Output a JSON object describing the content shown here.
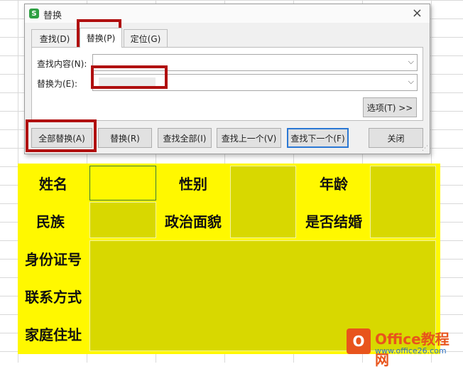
{
  "dialog": {
    "title": "替换",
    "tabs": [
      {
        "label": "查找(D)"
      },
      {
        "label": "替换(P)",
        "active": true
      },
      {
        "label": "定位(G)"
      }
    ],
    "find_label": "查找内容(N):",
    "find_value": "",
    "replace_label": "替换为(E):",
    "replace_value": "",
    "options_button": "选项(T) >>",
    "buttons": {
      "replace_all": "全部替换(A)",
      "replace": "替换(R)",
      "find_all": "查找全部(I)",
      "find_prev": "查找上一个(V)",
      "find_next": "查找下一个(F)",
      "close": "关闭"
    }
  },
  "sheet": {
    "labels": [
      "姓名",
      "性别",
      "年龄",
      "民族",
      "政治面貌",
      "是否结婚",
      "身份证号",
      "联系方式",
      "家庭住址"
    ],
    "fill_color": "#fff800",
    "value_cell_color": "#d8d800"
  },
  "watermark": {
    "title": "Office教程网",
    "url": "www.office26.com"
  },
  "colors": {
    "highlight_box": "#b01010",
    "focus_border": "#2b78d4"
  }
}
